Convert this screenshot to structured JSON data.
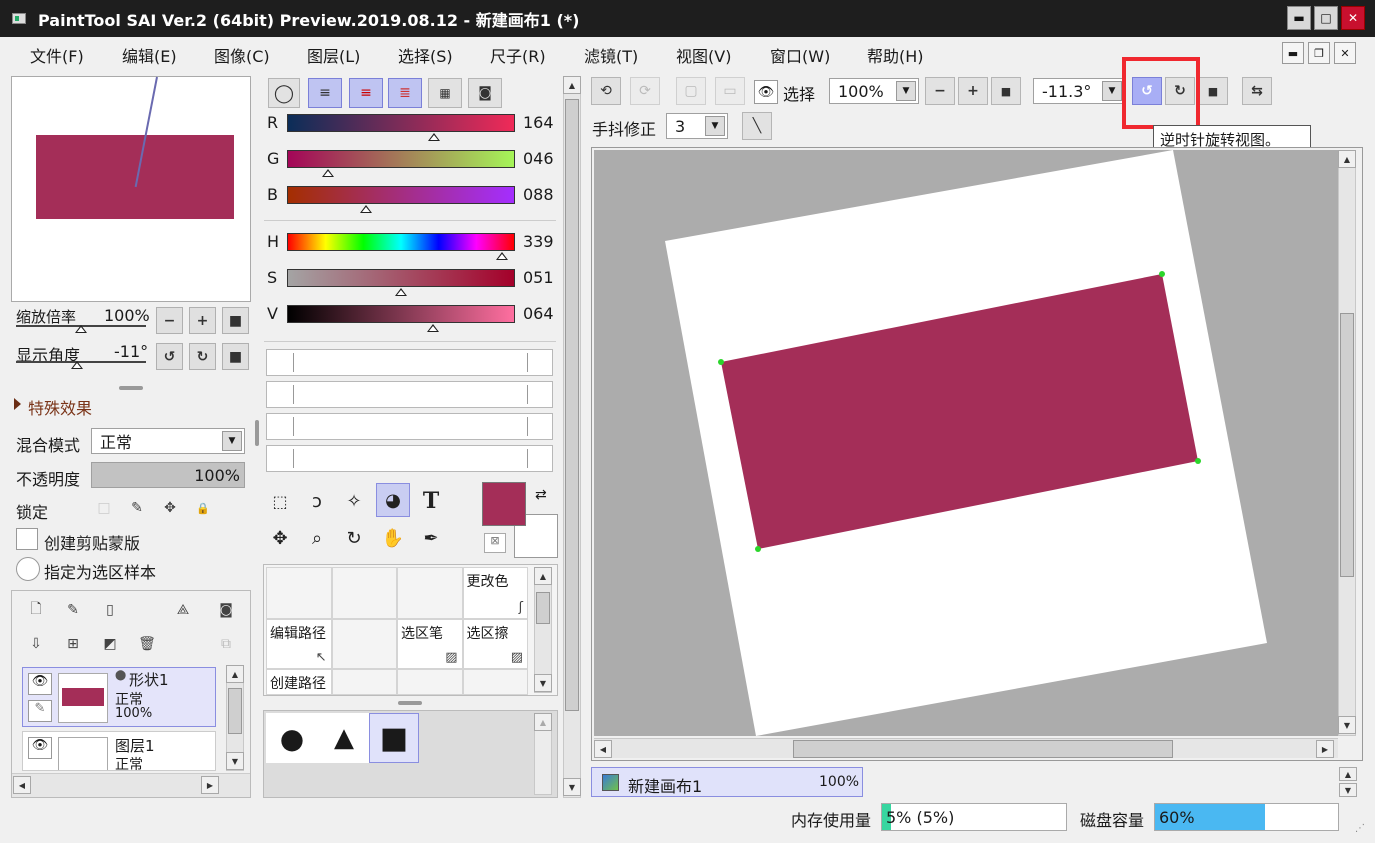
{
  "window": {
    "title": "PaintTool SAI Ver.2 (64bit) Preview.2019.08.12 - 新建画布1 (*)",
    "min_glyph": "▬",
    "max_glyph": "□",
    "close_glyph": "✕"
  },
  "menu": {
    "items": [
      "文件(F)",
      "编辑(E)",
      "图像(C)",
      "图层(L)",
      "选择(S)",
      "尺子(R)",
      "滤镜(T)",
      "视图(V)",
      "窗口(W)",
      "帮助(H)"
    ],
    "mdi_min": "▬",
    "mdi_restore": "❐",
    "mdi_close": "✕"
  },
  "navigator": {
    "zoom_label": "缩放倍率",
    "zoom_value": "100%",
    "angle_label": "显示角度",
    "angle_value": "-11°",
    "minus": "−",
    "plus": "+",
    "reset": "■",
    "rot_ccw": "↺",
    "rot_cw": "↻",
    "zoom_level": 0.5,
    "angle_level": 0.47
  },
  "layer_props": {
    "effects_label": "特殊效果",
    "blend_label": "混合模式",
    "blend_value": "正常",
    "opacity_label": "不透明度",
    "opacity_value": "100%",
    "opacity_level": 1.0,
    "lock_label": "锁定",
    "clip_label": "创建剪贴蒙版",
    "sample_label": "指定为选区样本",
    "lock_icons": [
      "□",
      "✎",
      "✥",
      "🔒"
    ]
  },
  "layers": {
    "items": [
      {
        "name": "形状1",
        "mode": "正常",
        "opacity": "100%",
        "selected": true
      },
      {
        "name": "图层1",
        "mode": "正常",
        "opacity": "",
        "selected": false
      }
    ],
    "eye_glyph": "👁",
    "pen_glyph": "✎"
  },
  "color": {
    "sliders": [
      {
        "label": "R",
        "value": "164",
        "level": 0.643,
        "gradient": "linear-gradient(to right,#0b2d58,#f02a58)"
      },
      {
        "label": "G",
        "value": "046",
        "level": 0.18,
        "gradient": "linear-gradient(to right,#a40558,#a5f558)"
      },
      {
        "label": "B",
        "value": "088",
        "level": 0.345,
        "gradient": "linear-gradient(to right,#a42e00,#a42eff)"
      },
      {
        "label": "H",
        "value": "339",
        "level": 0.942,
        "gradient": "linear-gradient(to right,#f00,#ff0,#0f0,#0ff,#00f,#f0f,#f00)"
      },
      {
        "label": "S",
        "value": "051",
        "level": 0.5,
        "gradient": "linear-gradient(to right,#a4a4a4,#a4002a)"
      },
      {
        "label": "V",
        "value": "064",
        "level": 0.64,
        "gradient": "linear-gradient(to right,#000,#ff6fa0)"
      }
    ],
    "primary": "#a42e58",
    "secondary": "#ffffff"
  },
  "tools": {
    "subtool_cells": [
      {
        "label": "",
        "corner": ""
      },
      {
        "label": "",
        "corner": ""
      },
      {
        "label": "",
        "corner": ""
      },
      {
        "label": "更改色",
        "corner": "ʃ"
      },
      {
        "label": "编辑路径",
        "corner": "↖"
      },
      {
        "label": "",
        "corner": ""
      },
      {
        "label": "选区笔",
        "corner": "▨"
      },
      {
        "label": "选区擦",
        "corner": "▨"
      },
      {
        "label": "创建路径",
        "corner": ""
      },
      {
        "label": "",
        "corner": ""
      },
      {
        "label": "",
        "corner": ""
      },
      {
        "label": "",
        "corner": ""
      }
    ]
  },
  "canvas_toolbar": {
    "select_label": "选择",
    "zoom_value": "100%",
    "angle_value": "-11.3°",
    "stabilizer_label": "手抖修正",
    "stabilizer_value": "3",
    "tooltip": "逆时针旋转视图。",
    "minus": "−",
    "plus": "+",
    "reset": "■",
    "undo": "⟲",
    "redo": "⟳",
    "rot_ccw": "↺",
    "rot_cw": "↻",
    "flip": "⇆",
    "line": "╲"
  },
  "canvas": {
    "shape_color": "#a42e58",
    "doc_tab": "新建画布1",
    "doc_zoom": "100%",
    "hscroll_pos": 0.32
  },
  "status": {
    "memory_label": "内存使用量",
    "memory_value": "5% (5%)",
    "memory_level": 0.05,
    "disk_label": "磁盘容量",
    "disk_value": "60%",
    "disk_level": 0.6
  }
}
